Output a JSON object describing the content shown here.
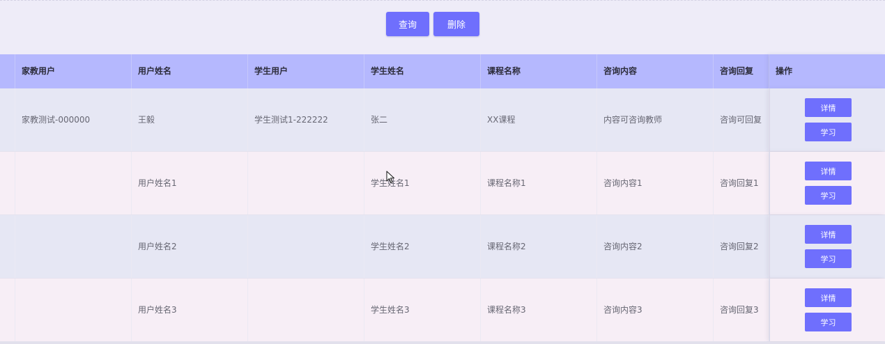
{
  "toolbar": {
    "query_label": "查询",
    "delete_label": "删除"
  },
  "table": {
    "headers": {
      "tutor_user": "家教用户",
      "user_name": "用户姓名",
      "student_user": "学生用户",
      "student_name": "学生姓名",
      "course_name": "课程名称",
      "consult_content": "咨询内容",
      "consult_reply": "咨询回复",
      "actions": "操作"
    },
    "rows": [
      {
        "tutor_user": "家教测试-000000",
        "user_name": "王毅",
        "student_user": "学生测试1-222222",
        "student_name": "张二",
        "course_name": "XX课程",
        "consult_content": "内容可咨询教师",
        "consult_reply": "咨询可回复"
      },
      {
        "tutor_user": "",
        "user_name": "用户姓名1",
        "student_user": "",
        "student_name": "学生姓名1",
        "course_name": "课程名称1",
        "consult_content": "咨询内容1",
        "consult_reply": "咨询回复1"
      },
      {
        "tutor_user": "",
        "user_name": "用户姓名2",
        "student_user": "",
        "student_name": "学生姓名2",
        "course_name": "课程名称2",
        "consult_content": "咨询内容2",
        "consult_reply": "咨询回复2"
      },
      {
        "tutor_user": "",
        "user_name": "用户姓名3",
        "student_user": "",
        "student_name": "学生姓名3",
        "course_name": "课程名称3",
        "consult_content": "咨询内容3",
        "consult_reply": "咨询回复3"
      }
    ],
    "row_actions": {
      "detail_label": "详情",
      "study_label": "学习"
    }
  },
  "colors": {
    "accent": "#6f6ffd",
    "header_bg": "#b5b8fe",
    "row_odd_bg": "#e6e7f4",
    "row_even_bg": "#f7eef6",
    "page_bg": "#eeecf8"
  }
}
